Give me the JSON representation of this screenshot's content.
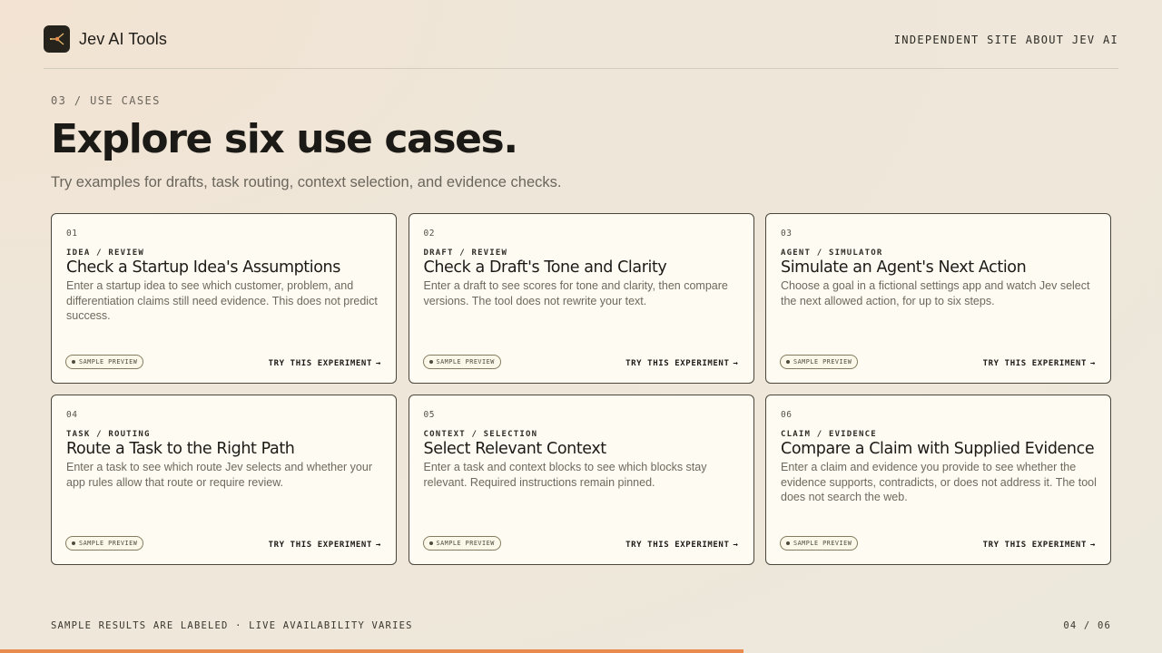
{
  "header": {
    "brand": "Jev AI Tools",
    "logo_icon": "spark-node-icon",
    "site_link": "INDEPENDENT SITE ABOUT JEV AI"
  },
  "section": {
    "eyebrow": "03 / USE CASES",
    "title": "Explore six use cases.",
    "subtitle": "Try examples for drafts, task routing, context selection, and evidence checks."
  },
  "cards": [
    {
      "num": "01",
      "category": "IDEA / REVIEW",
      "title": "Check a Startup Idea's Assumptions",
      "desc": "Enter a startup idea to see which customer, problem, and differentiation claims still need evidence. This does not predict success.",
      "badge": "SAMPLE PREVIEW",
      "cta": "TRY THIS EXPERIMENT"
    },
    {
      "num": "02",
      "category": "DRAFT / REVIEW",
      "title": "Check a Draft's Tone and Clarity",
      "desc": "Enter a draft to see scores for tone and clarity, then compare versions. The tool does not rewrite your text.",
      "badge": "SAMPLE PREVIEW",
      "cta": "TRY THIS EXPERIMENT"
    },
    {
      "num": "03",
      "category": "AGENT / SIMULATOR",
      "title": "Simulate an Agent's Next Action",
      "desc": "Choose a goal in a fictional settings app and watch Jev select the next allowed action, for up to six steps.",
      "badge": "SAMPLE PREVIEW",
      "cta": "TRY THIS EXPERIMENT"
    },
    {
      "num": "04",
      "category": "TASK / ROUTING",
      "title": "Route a Task to the Right Path",
      "desc": "Enter a task to see which route Jev selects and whether your app rules allow that route or require review.",
      "badge": "SAMPLE PREVIEW",
      "cta": "TRY THIS EXPERIMENT"
    },
    {
      "num": "05",
      "category": "CONTEXT / SELECTION",
      "title": "Select Relevant Context",
      "desc": "Enter a task and context blocks to see which blocks stay relevant. Required instructions remain pinned.",
      "badge": "SAMPLE PREVIEW",
      "cta": "TRY THIS EXPERIMENT"
    },
    {
      "num": "06",
      "category": "CLAIM / EVIDENCE",
      "title": "Compare a Claim with Supplied Evidence",
      "desc": "Enter a claim and evidence you provide to see whether the evidence supports, contradicts, or does not address it. The tool does not search the web.",
      "badge": "SAMPLE PREVIEW",
      "cta": "TRY THIS EXPERIMENT"
    }
  ],
  "footer": {
    "note": "SAMPLE RESULTS ARE LABELED · LIVE AVAILABILITY VARIES",
    "pager": "04 / 06",
    "progress_fraction": 0.64
  },
  "colors": {
    "accent": "#e98a4e",
    "card_bg": "#fdfbf2",
    "ink": "#1c1a16"
  }
}
